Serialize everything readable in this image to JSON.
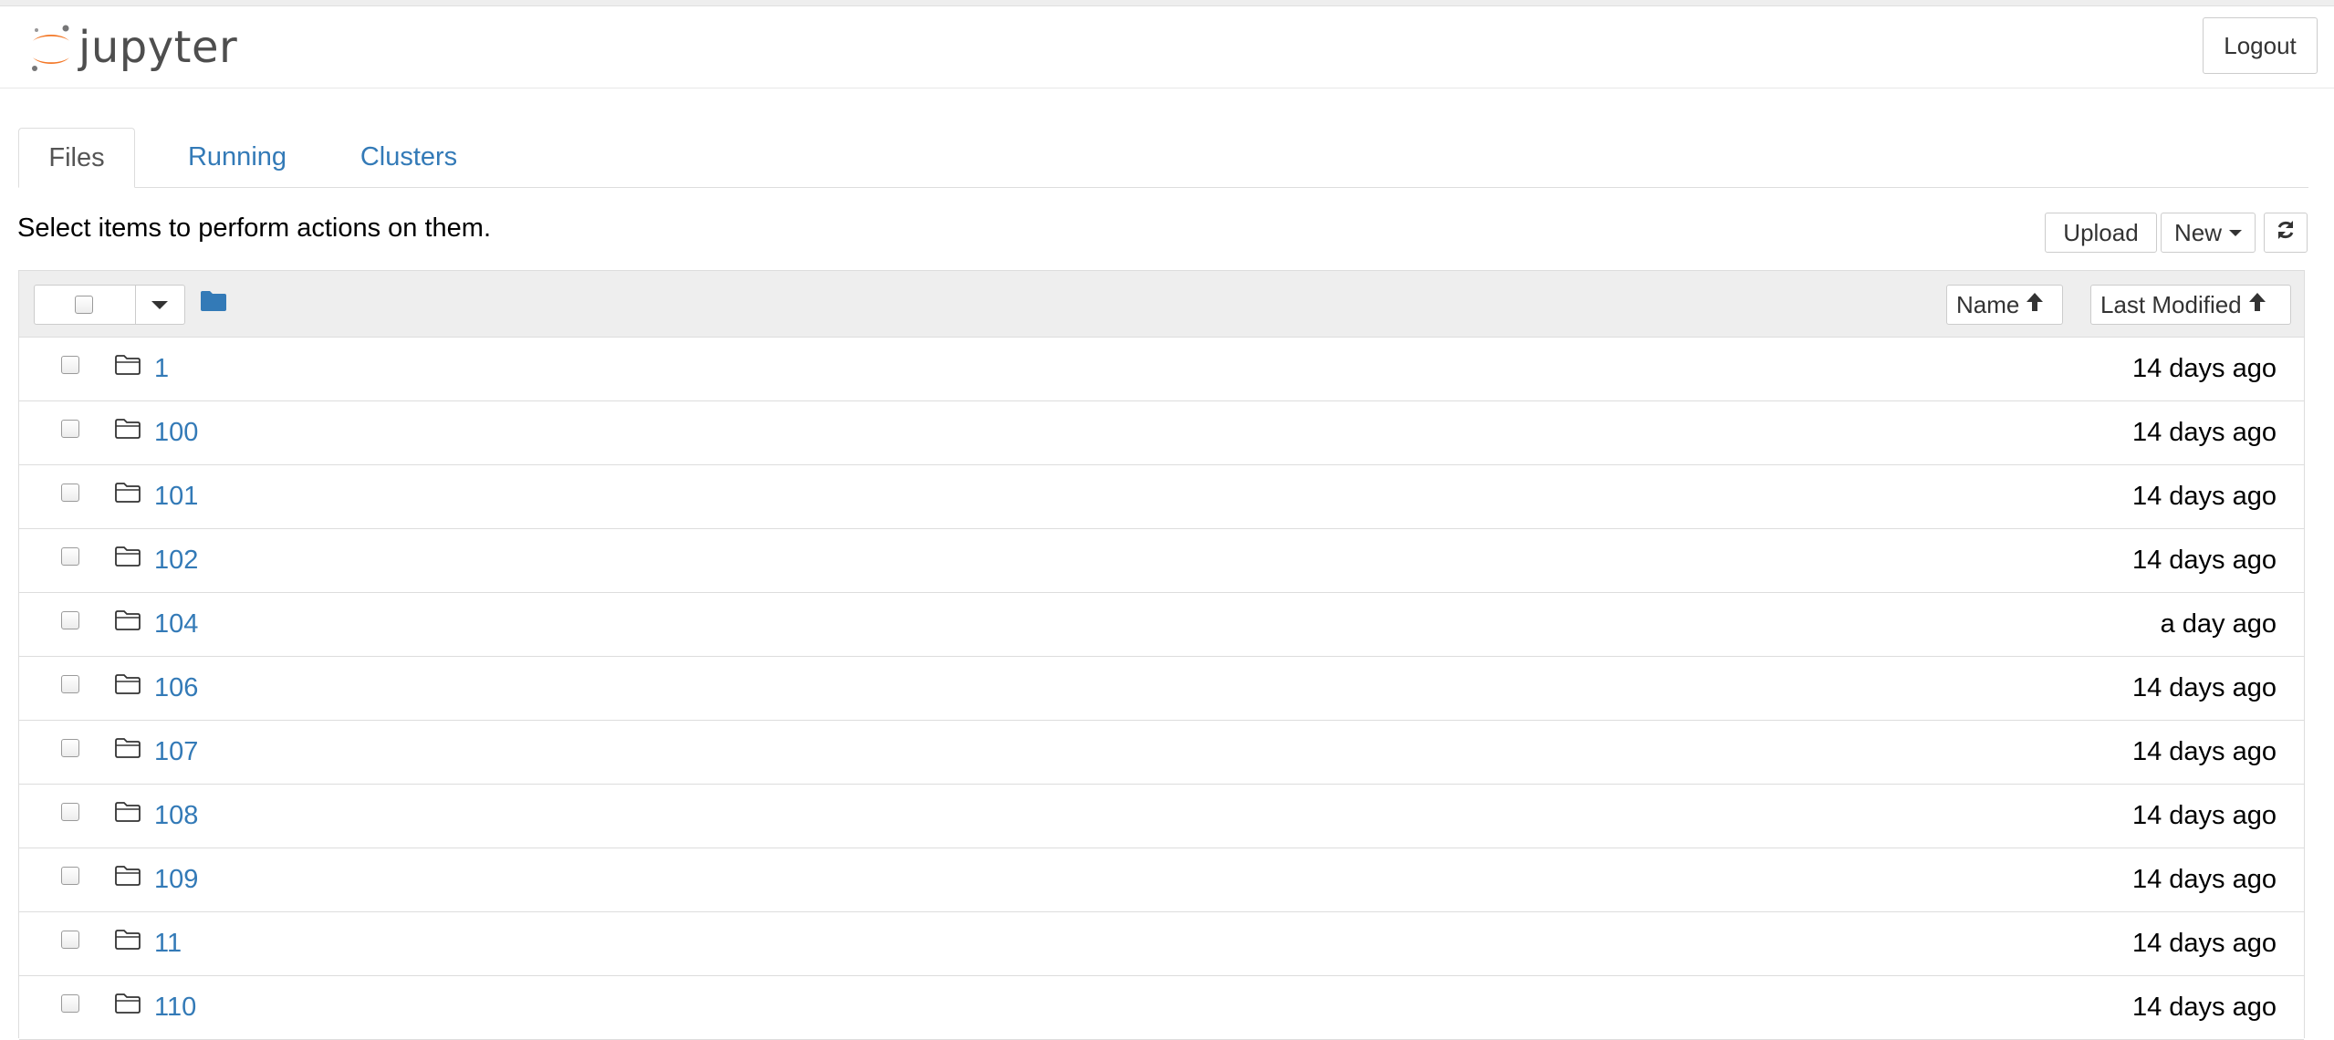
{
  "header": {
    "logo_text": "jupyter",
    "logout_label": "Logout"
  },
  "tabs": [
    {
      "label": "Files",
      "active": true
    },
    {
      "label": "Running",
      "active": false
    },
    {
      "label": "Clusters",
      "active": false
    }
  ],
  "toolbar": {
    "instructions": "Select items to perform actions on them.",
    "upload_label": "Upload",
    "new_label": "New",
    "refresh_icon": "refresh-icon"
  },
  "list_header": {
    "name_label": "Name",
    "last_modified_label": "Last Modified"
  },
  "files": [
    {
      "name": "1",
      "modified": "14 days ago",
      "type": "folder"
    },
    {
      "name": "100",
      "modified": "14 days ago",
      "type": "folder"
    },
    {
      "name": "101",
      "modified": "14 days ago",
      "type": "folder"
    },
    {
      "name": "102",
      "modified": "14 days ago",
      "type": "folder"
    },
    {
      "name": "104",
      "modified": "a day ago",
      "type": "folder"
    },
    {
      "name": "106",
      "modified": "14 days ago",
      "type": "folder"
    },
    {
      "name": "107",
      "modified": "14 days ago",
      "type": "folder"
    },
    {
      "name": "108",
      "modified": "14 days ago",
      "type": "folder"
    },
    {
      "name": "109",
      "modified": "14 days ago",
      "type": "folder"
    },
    {
      "name": "11",
      "modified": "14 days ago",
      "type": "folder"
    },
    {
      "name": "110",
      "modified": "14 days ago",
      "type": "folder"
    }
  ],
  "colors": {
    "link": "#337ab7",
    "logo_orange": "#f37726",
    "logo_gray": "#767677",
    "header_bg": "#eeeeee"
  }
}
